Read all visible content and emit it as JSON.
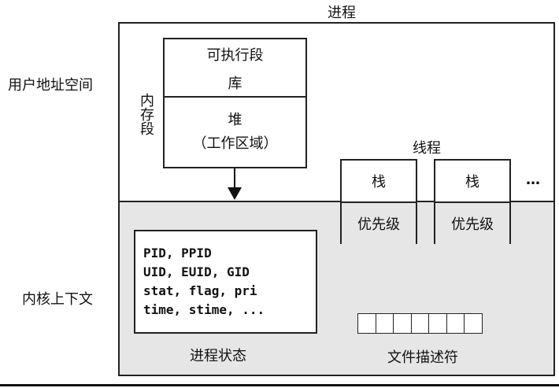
{
  "title": "进程",
  "left_labels": {
    "user_space": "用户地址空间",
    "kernel_context": "内核上下文"
  },
  "memory_segments": {
    "vertical_label": "内存段",
    "executable": "可执行段",
    "library": "库",
    "heap_line1": "堆",
    "heap_line2": "（工作区域）"
  },
  "threads": {
    "label": "线程",
    "items": [
      {
        "stack": "栈",
        "priority": "优先级"
      },
      {
        "stack": "栈",
        "priority": "优先级"
      }
    ],
    "ellipsis": "…"
  },
  "process_state": {
    "lines": [
      "PID, PPID",
      "UID, EUID, GID",
      "stat, flag, pri",
      "time, stime, ..."
    ],
    "caption": "进程状态"
  },
  "file_descriptors": {
    "cell_count": 7,
    "caption": "文件描述符"
  }
}
